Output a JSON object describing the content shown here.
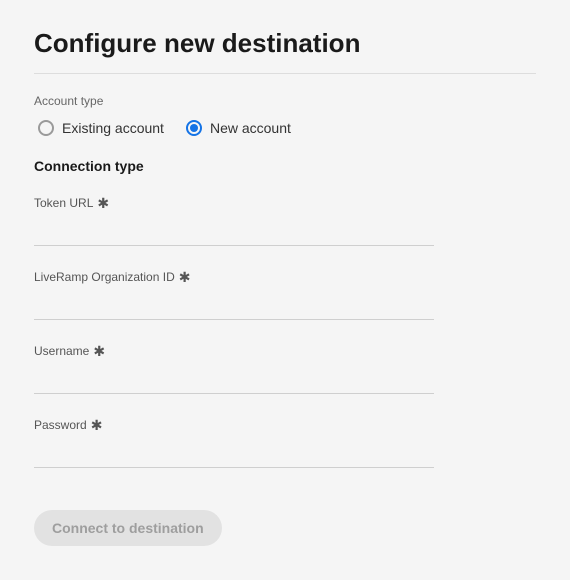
{
  "title": "Configure new destination",
  "account_type": {
    "label": "Account type",
    "options": [
      {
        "label": "Existing account",
        "selected": false
      },
      {
        "label": "New account",
        "selected": true
      }
    ]
  },
  "connection_type": {
    "heading": "Connection type",
    "fields": [
      {
        "label": "Token URL",
        "required": "✱",
        "value": ""
      },
      {
        "label": "LiveRamp Organization ID",
        "required": "✱",
        "value": ""
      },
      {
        "label": "Username",
        "required": "✱",
        "value": ""
      },
      {
        "label": "Password",
        "required": "✱",
        "value": ""
      }
    ]
  },
  "connect_button": "Connect to destination"
}
